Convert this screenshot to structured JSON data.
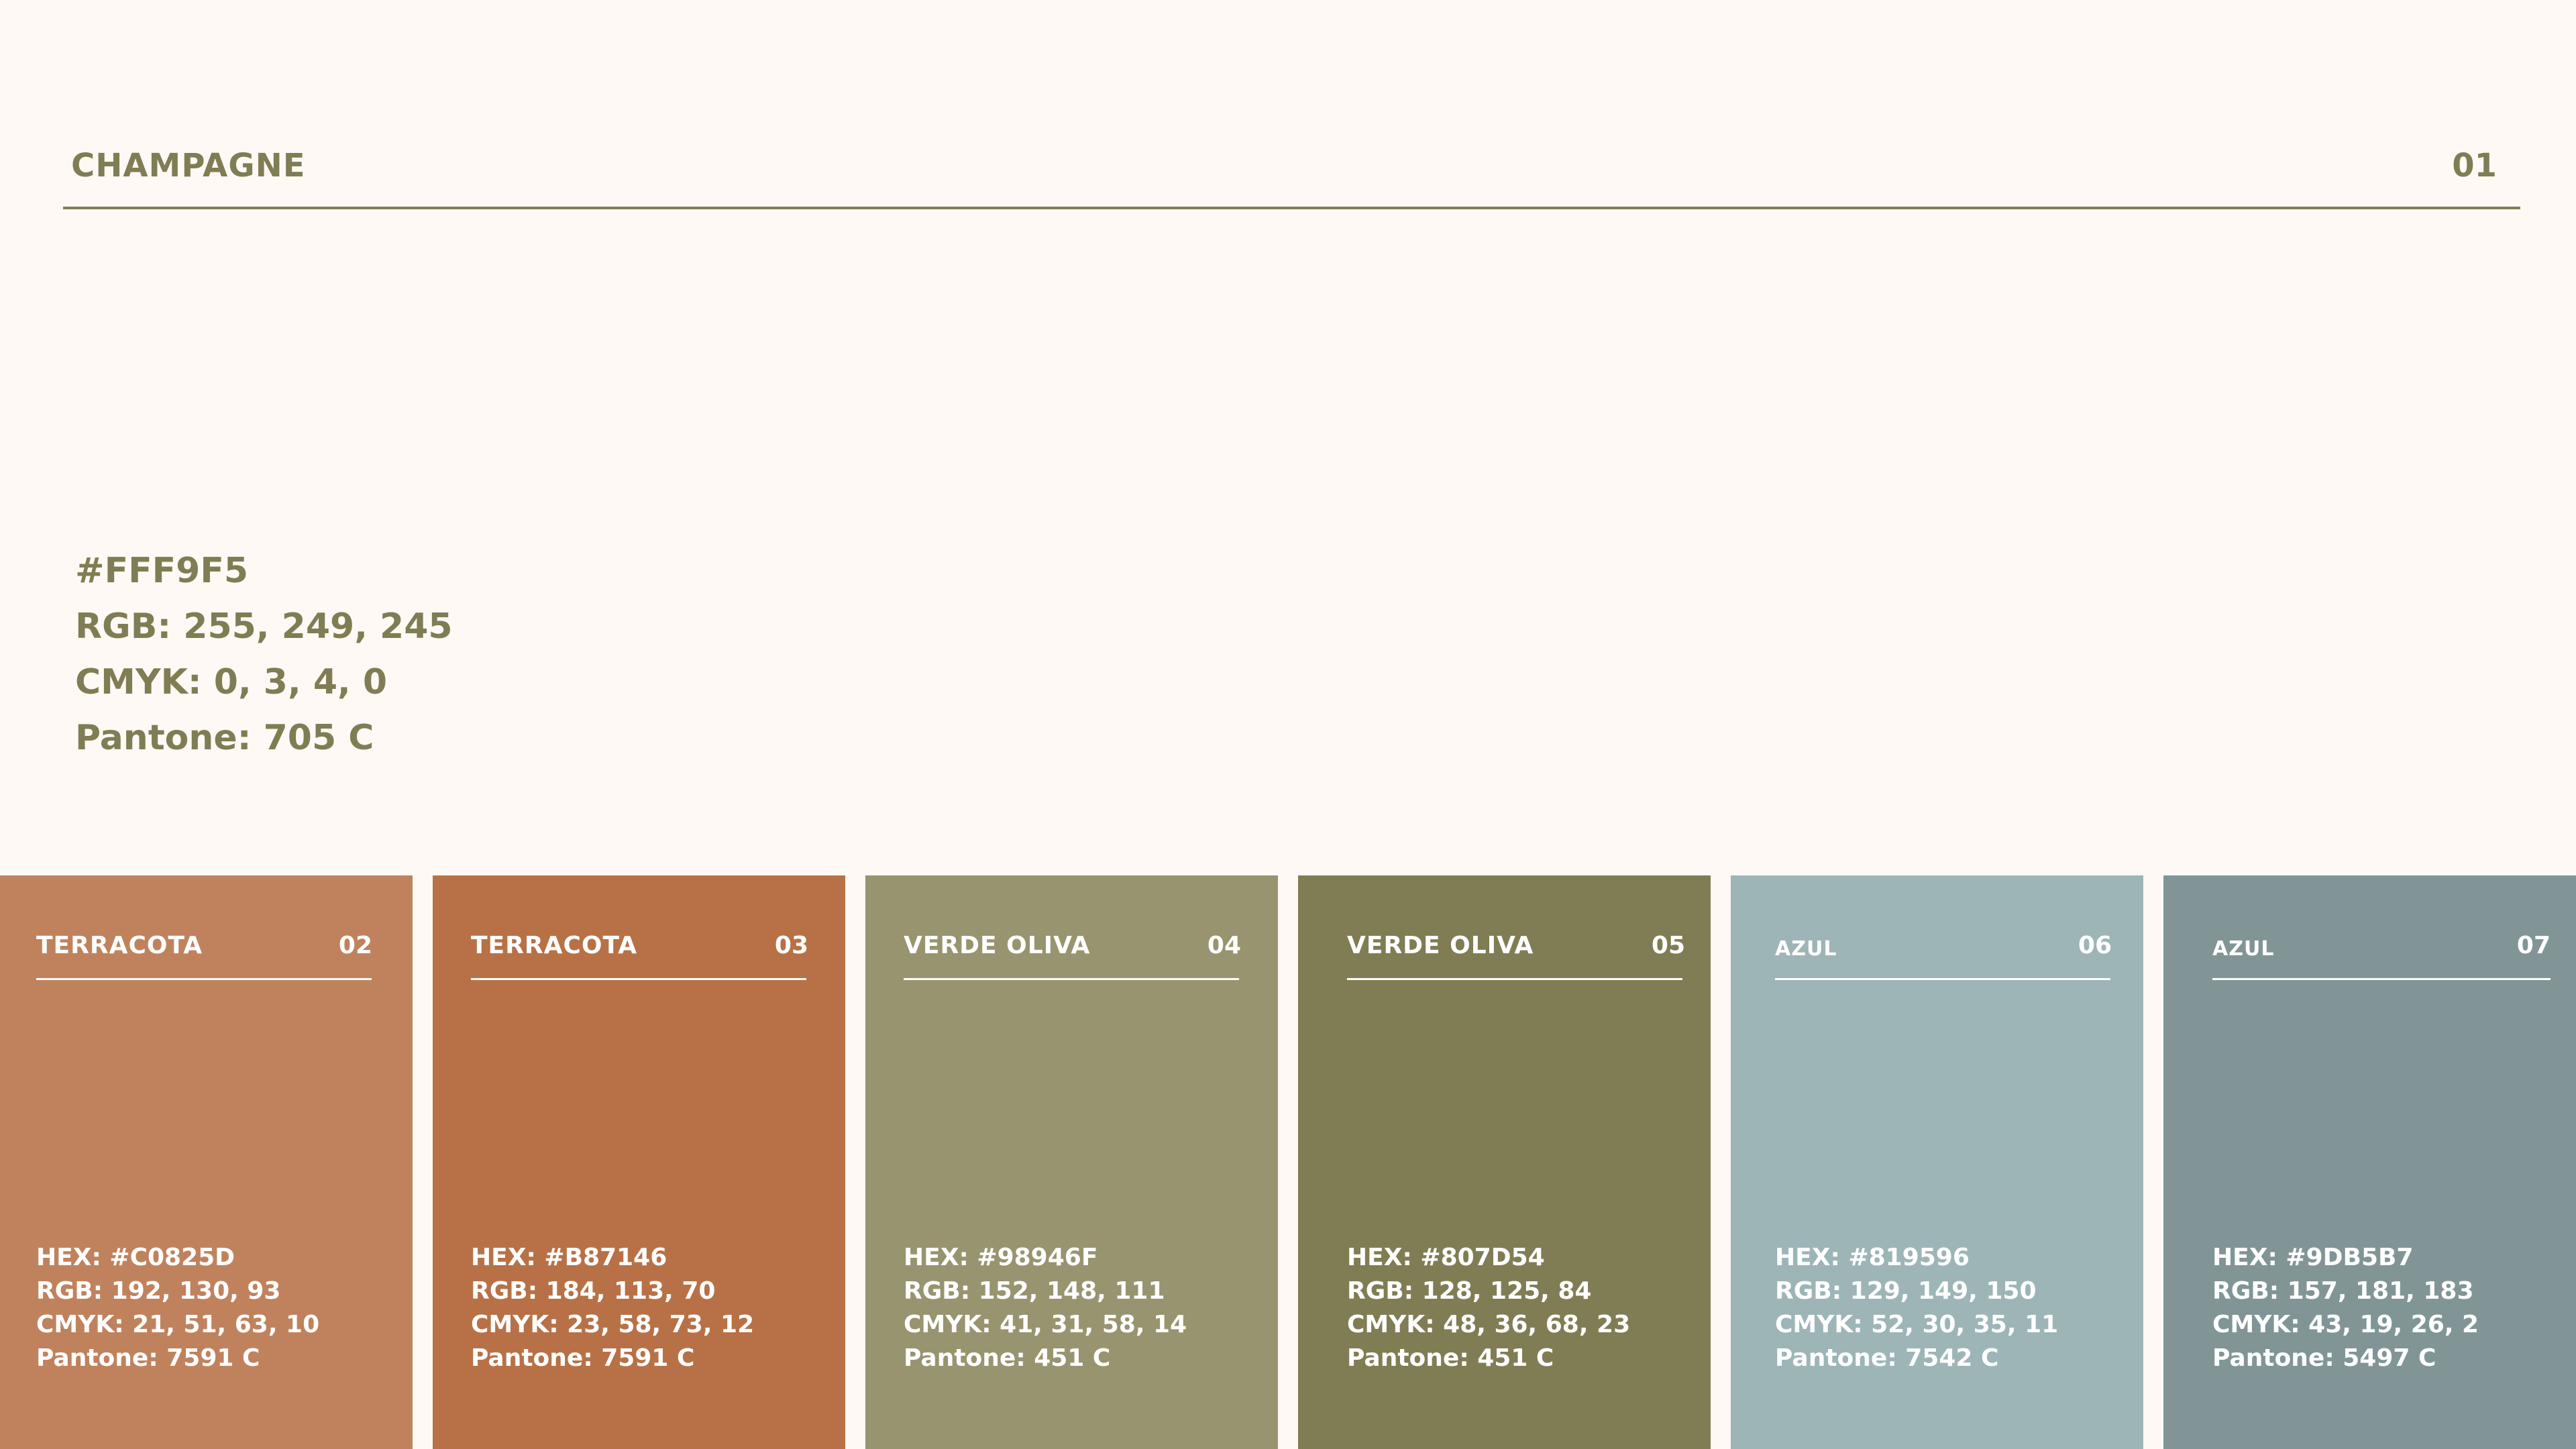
{
  "hero": {
    "name": "CHAMPAGNE",
    "number": "01",
    "hex": "#FFF9F5",
    "rgb": "RGB: 255, 249, 245",
    "cmyk": "CMYK: 0, 3, 4, 0",
    "pantone": "Pantone: 705 C",
    "color": "#FFF9F5",
    "text_color": "#807D54"
  },
  "swatches": [
    {
      "name": "TERRACOTA",
      "number": "02",
      "hex": "HEX: #C0825D",
      "rgb": "RGB: 192, 130, 93",
      "cmyk": "CMYK: 21, 51, 63, 10",
      "pantone": "Pantone: 7591 C",
      "color": "#C0825D"
    },
    {
      "name": "TERRACOTA",
      "number": "03",
      "hex": "HEX: #B87146",
      "rgb": "RGB: 184, 113, 70",
      "cmyk": "CMYK: 23, 58, 73, 12",
      "pantone": "Pantone: 7591 C",
      "color": "#B87146"
    },
    {
      "name": "VERDE OLIVA",
      "number": "04",
      "hex": "HEX: #98946F",
      "rgb": "RGB: 152, 148, 111",
      "cmyk": "CMYK: 41, 31, 58, 14",
      "pantone": "Pantone: 451 C",
      "color": "#98946F"
    },
    {
      "name": "VERDE OLIVA",
      "number": "05",
      "hex": "HEX: #807D54",
      "rgb": "RGB: 128, 125, 84",
      "cmyk": "CMYK: 48, 36, 68, 23",
      "pantone": "Pantone: 451 C",
      "color": "#807D54"
    },
    {
      "name": "AZUL",
      "number": "06",
      "hex": "HEX: #819596",
      "rgb": "RGB: 129, 149, 150",
      "cmyk": "CMYK: 52, 30, 35, 11",
      "pantone": "Pantone: 7542 C",
      "color": "#9DB5B7"
    },
    {
      "name": "AZUL",
      "number": "07",
      "hex": "HEX: #9DB5B7",
      "rgb": "RGB: 157, 181, 183",
      "cmyk": "CMYK: 43, 19, 26, 2",
      "pantone": "Pantone: 5497 C",
      "color": "#819596"
    }
  ]
}
